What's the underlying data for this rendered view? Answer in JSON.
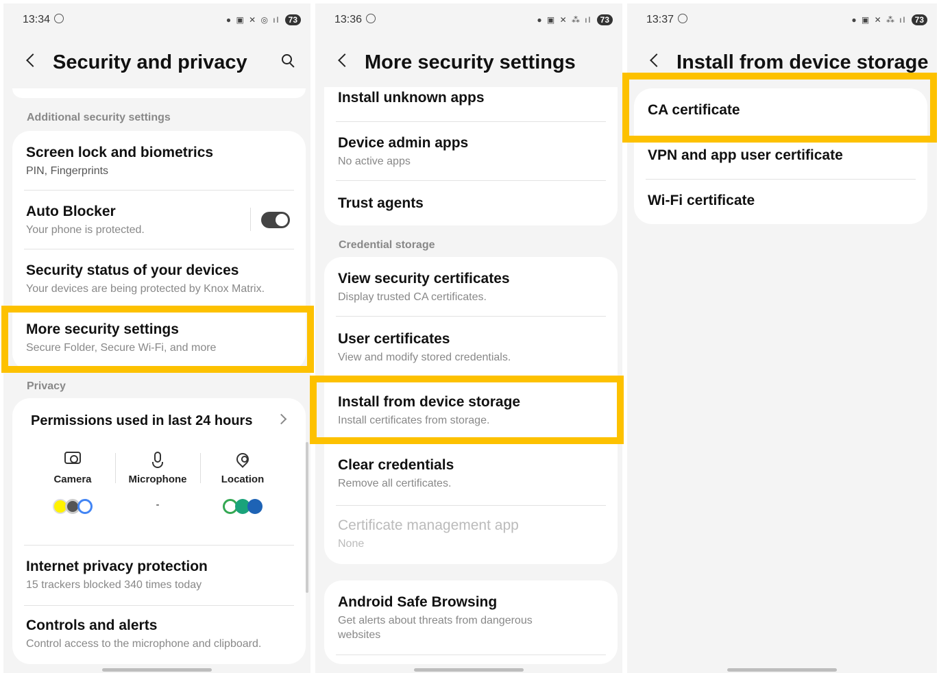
{
  "screen1": {
    "time": "13:34",
    "battery": "73",
    "title": "Security and privacy",
    "section_additional": "Additional security settings",
    "items": [
      {
        "title": "Screen lock and biometrics",
        "subtitle": "PIN, Fingerprints"
      },
      {
        "title": "Auto Blocker",
        "subtitle": "Your phone is protected."
      },
      {
        "title": "Security status of your devices",
        "subtitle": "Your devices are being protected by Knox Matrix."
      },
      {
        "title": "More security settings",
        "subtitle": "Secure Folder, Secure Wi-Fi, and more"
      }
    ],
    "section_privacy": "Privacy",
    "permissions_title": "Permissions used in last 24 hours",
    "permissions": [
      {
        "label": "Camera",
        "icon": "camera-icon"
      },
      {
        "label": "Microphone",
        "icon": "microphone-icon",
        "apps": "-"
      },
      {
        "label": "Location",
        "icon": "location-icon"
      }
    ],
    "items2": [
      {
        "title": "Internet privacy protection",
        "subtitle": "15 trackers blocked 340 times today"
      },
      {
        "title": "Controls and alerts",
        "subtitle": "Control access to the microphone and clipboard."
      }
    ],
    "auto_blocker_on": true
  },
  "screen2": {
    "time": "13:36",
    "battery": "73",
    "title": "More security settings",
    "items": [
      {
        "title": "Install unknown apps"
      },
      {
        "title": "Device admin apps",
        "subtitle": "No active apps"
      },
      {
        "title": "Trust agents"
      }
    ],
    "section_credential": "Credential storage",
    "cred_items": [
      {
        "title": "View security certificates",
        "subtitle": "Display trusted CA certificates."
      },
      {
        "title": "User certificates",
        "subtitle": "View and modify stored credentials."
      },
      {
        "title": "Install from device storage",
        "subtitle": "Install certificates from storage."
      },
      {
        "title": "Clear credentials",
        "subtitle": "Remove all certificates."
      },
      {
        "title": "Certificate management app",
        "subtitle": "None"
      }
    ],
    "safe_browsing": {
      "title": "Android Safe Browsing",
      "subtitle": "Get alerts about threats from dangerous websites"
    }
  },
  "screen3": {
    "time": "13:37",
    "battery": "73",
    "title": "Install from device storage",
    "items": [
      {
        "title": "CA certificate"
      },
      {
        "title": "VPN and app user certificate"
      },
      {
        "title": "Wi-Fi certificate"
      }
    ]
  },
  "colors": {
    "highlight": "#fdc100",
    "background": "#f4f4f4",
    "card": "#ffffff"
  }
}
